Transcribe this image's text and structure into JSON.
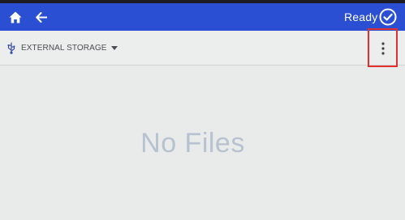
{
  "topbar": {
    "home_icon": "home-icon",
    "back_icon": "arrow-left-icon",
    "status_text": "Ready",
    "status_icon": "check-circle-icon",
    "bar_color": "#2a4fd2"
  },
  "storage": {
    "icon": "usb-icon",
    "label": "EXTERNAL STORAGE",
    "dropdown_icon": "caret-down-icon"
  },
  "menu": {
    "icon": "more-vertical-icon",
    "highlight_color": "#e23030"
  },
  "file_list": {
    "empty_message": "No Files"
  }
}
